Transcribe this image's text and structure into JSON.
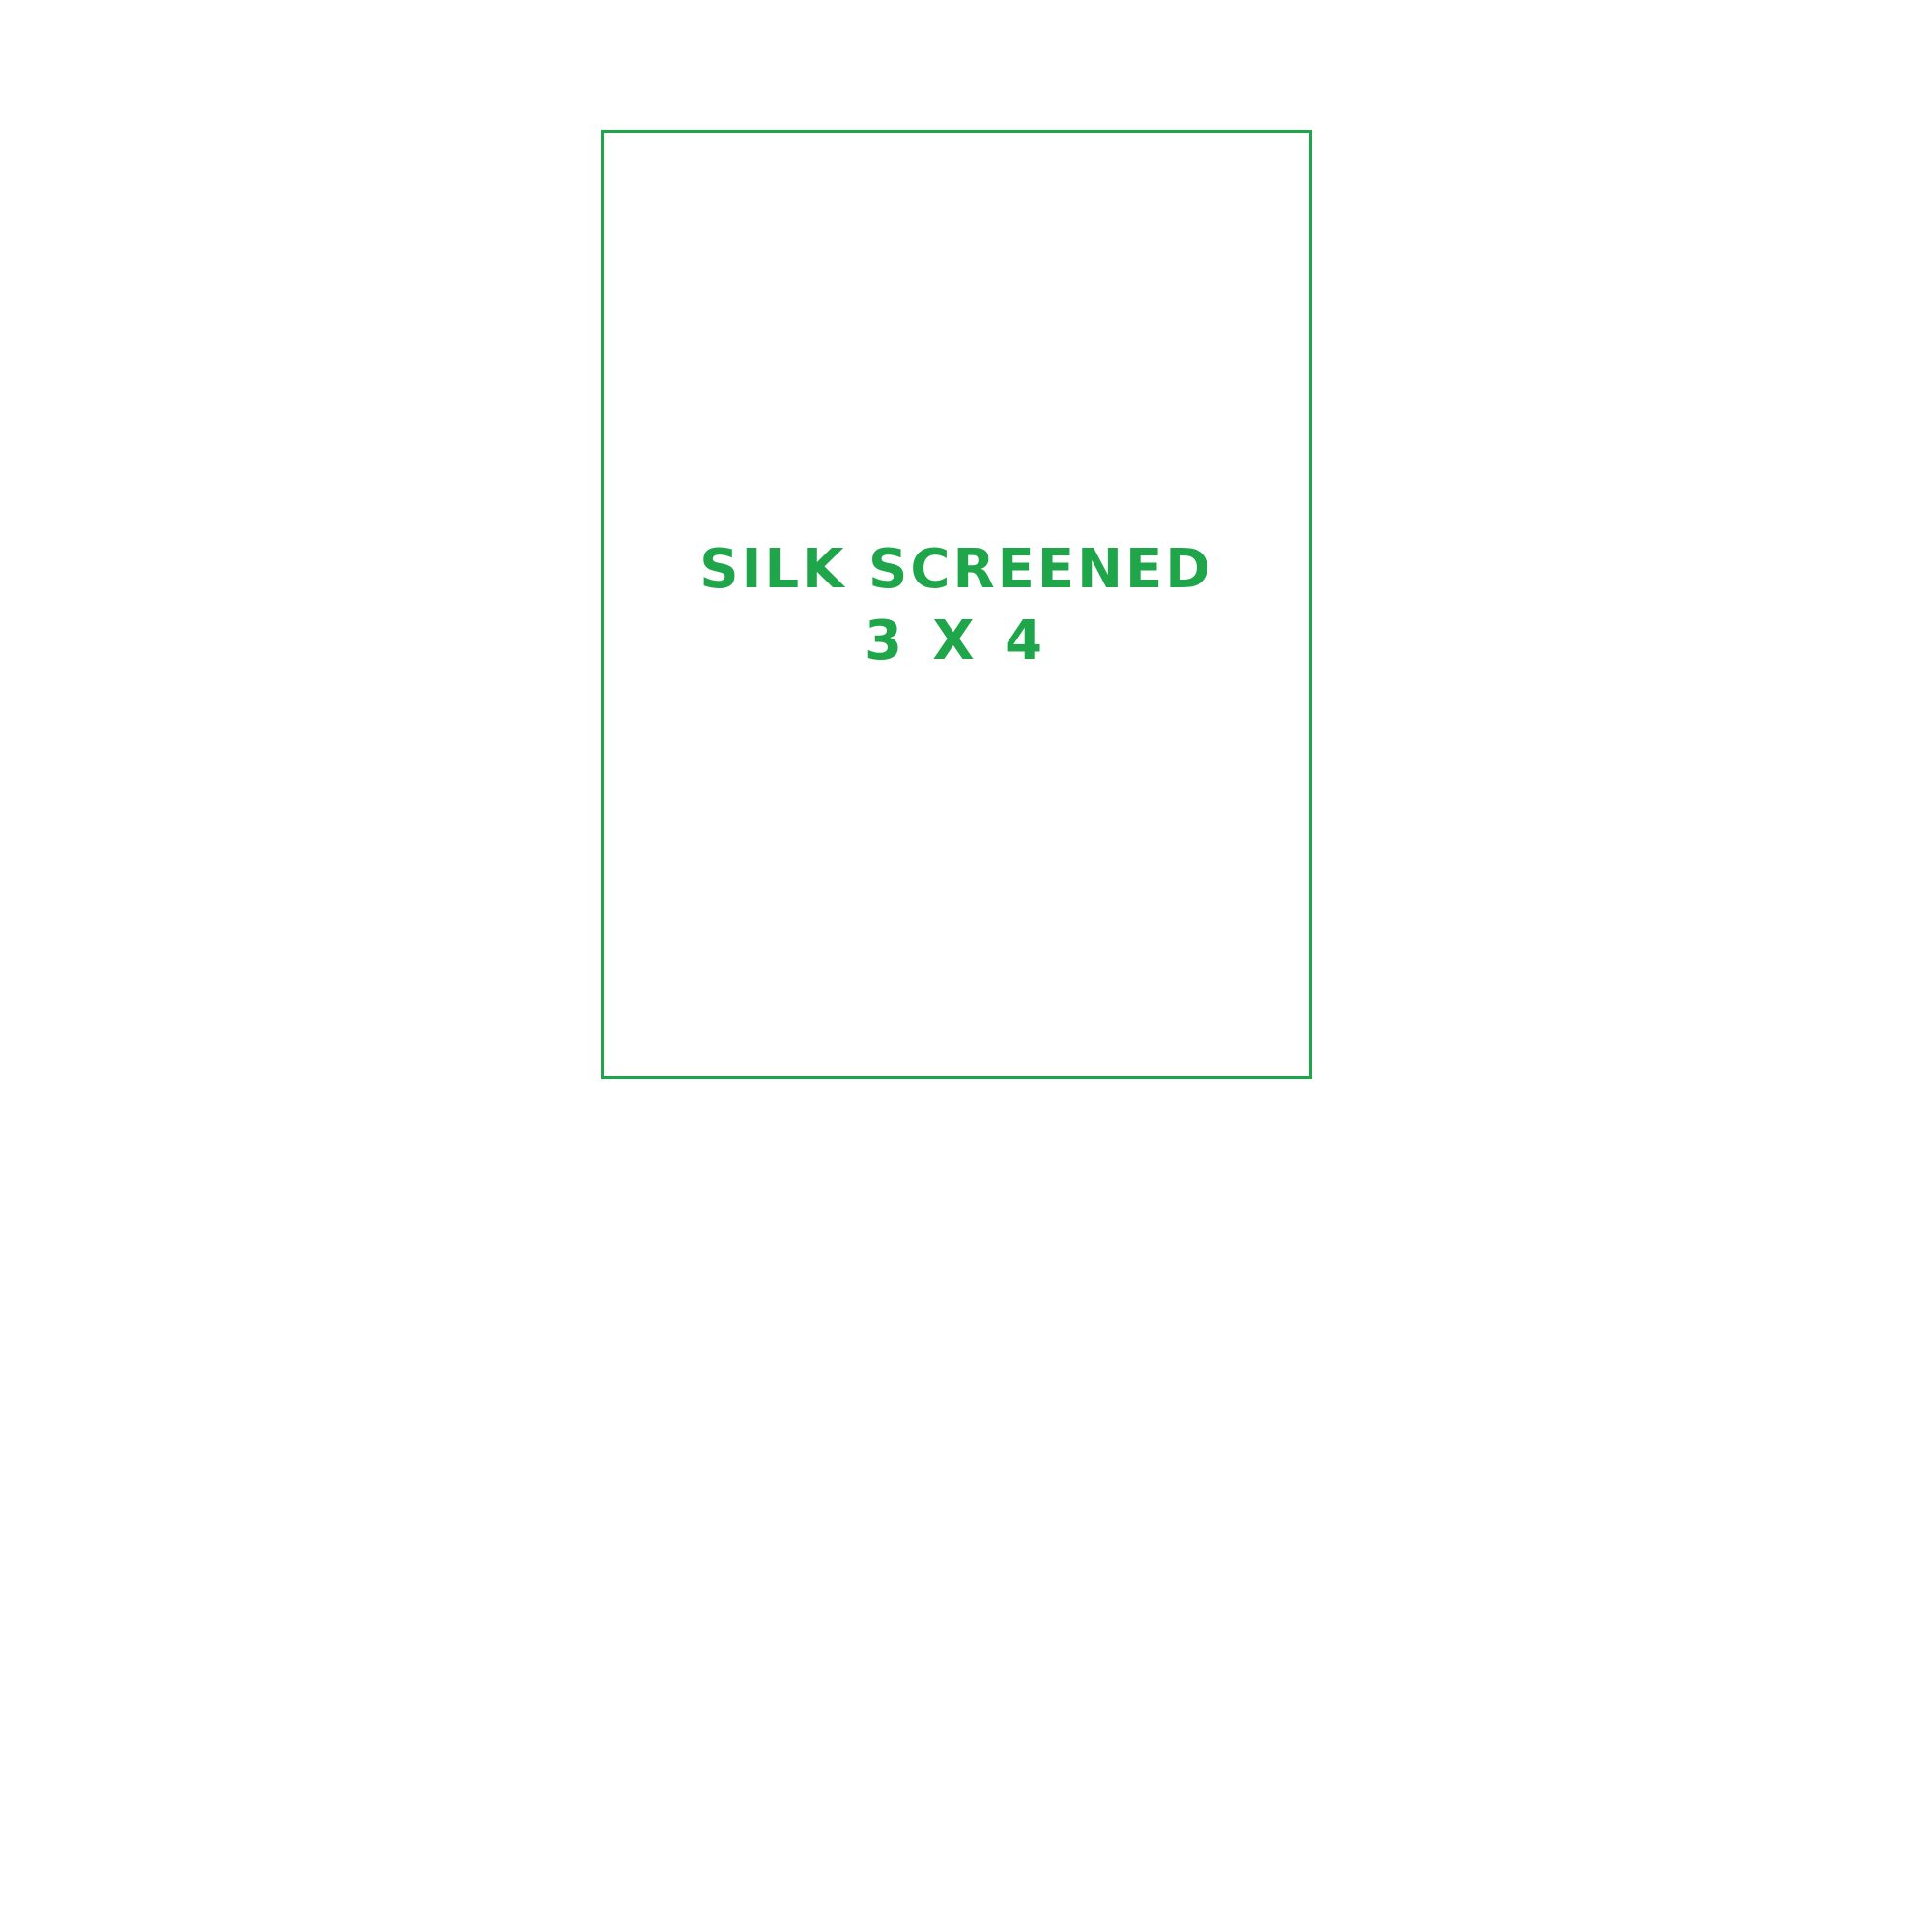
{
  "colors": {
    "accent": "#1fa64a",
    "background": "#ffffff"
  },
  "print_area": {
    "line1": "SILK SCREENED",
    "line2": "3 X 4"
  }
}
